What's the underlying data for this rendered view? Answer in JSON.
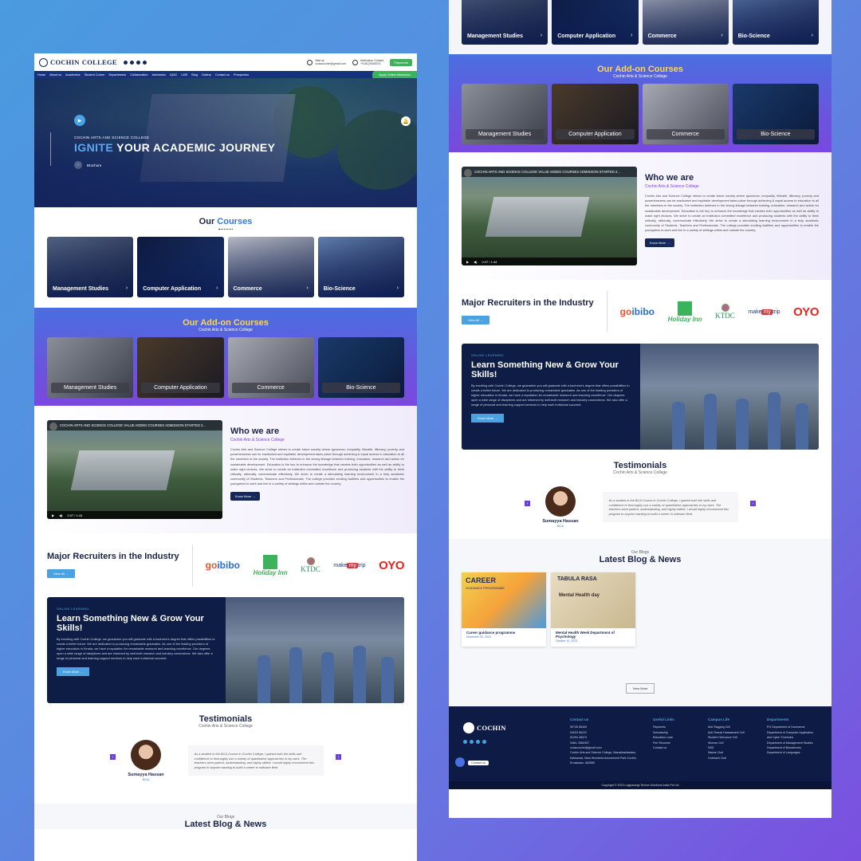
{
  "site": {
    "logo": "COCHIN ARTS & SCIENCE COLLEGE",
    "logo_short": "COCHIN",
    "logo_tail": "COLLEGE"
  },
  "header": {
    "mail_label": "Mail us",
    "mail": "ccasccochin@gmail.com",
    "phone_label": "Admission Contact",
    "phone": "+918129448374",
    "payments": "Payments",
    "apply": "Apply Online Admission"
  },
  "nav": [
    "Home",
    "About us",
    "Academics",
    "Student Corner",
    "Departments",
    "Collaboration",
    "Admission",
    "IQAC",
    "LMS",
    "Blog",
    "Gallery",
    "Contact us",
    "Prospectus"
  ],
  "hero": {
    "sub": "COCHIN ARTS AND SCIENCE COLLEGE",
    "title_hl": "IGNITE",
    "title_rest": " YOUR ACADEMIC JOURNEY",
    "brochure": "Brochure"
  },
  "courses": {
    "title_a": "Our ",
    "title_b": "Courses",
    "items": [
      {
        "label": "Management Studies"
      },
      {
        "label": "Computer Application"
      },
      {
        "label": "Commerce"
      },
      {
        "label": "Bio-Science"
      }
    ]
  },
  "addon": {
    "title": "Our Add-on Courses",
    "sub": "Cochin Arts & Science College",
    "items": [
      {
        "label": "Management Studies"
      },
      {
        "label": "Computer Application"
      },
      {
        "label": "Commerce"
      },
      {
        "label": "Bio-Science"
      }
    ]
  },
  "who": {
    "video_title": "COCHIN ARTS AND SCIENCE COLLEGE VALUE ADDED COURSES ADMISSION STARTED 2...",
    "video_time": "0:07 / 1:44",
    "title": "Who we are",
    "sub": "Cochin Arts & Science College",
    "text": "Cochin Arts and Science College strives to create future society where ignorance, inequality, illhealth, illiteracy, poverty and powerlessness can be eradicated and equitable development takes place through achieving & equal access to education to all the members in the society. The institution believes in the strong linkage between training, education, research and action for sustainable development. Education is the key to enhance the knowledge that creates both opportunities as well as ability to make right choices. We strive to create an institution committed excellence and producing students with the ability to think critically, rationally, communicate effectively. We strive to create a stimulating learning environment in a truly academic community of Students, Teachers and Professionals. The college provides exciting facilities and opportunities to enable the youngsters to work and live in a variety of settings within and outside the country.",
    "button": "Know More →"
  },
  "recruiters": {
    "title": "Major Recruiters in the Industry",
    "button": "View All →",
    "logos": {
      "goibibo_a": "go",
      "goibibo_b": "ibibo",
      "holiday": "Holiday Inn",
      "ktdc": "KTDC",
      "mmt_a": "make",
      "mmt_b": "my",
      "mmt_c": "trip",
      "oyo": "OYO"
    }
  },
  "learn": {
    "kicker": "ONLINE LEARNING",
    "title": "Learn Something New & Grow Your Skills!",
    "text": "By enrolling with Cochin College, we guarantee you will graduate with a bachelor's degree that offers possibilities to create a better future. We are dedicated to producing remarkable graduates. As one of the leading providers of higher education in Kerala, we have a reputation for remarkable research and teaching excellence. Our degrees open a wide range of disciplines and are informed by well-built research and industry connections. We also offer a range of personal and learning support services to help each individual succeed.",
    "button": "Know More →"
  },
  "testimonials": {
    "title": "Testimonials",
    "sub": "Cochin Arts & Science College",
    "name": "Sumayya Hassan",
    "course": "BCA",
    "quote": "As a student in the BCA Course in Cochin College, I gained both the skills and confidence to thoroughly use a variety of quantitative approaches in my work. The teachers were patient, understanding, and highly skilled. I would highly recommend this program to anyone wanting to build a career in software field."
  },
  "blog": {
    "kicker": "Our Blogs",
    "title": "Latest Blog & News",
    "posts": [
      {
        "title": "Career guidance programme",
        "date": "November 02, 2023",
        "img_a": "CAREER",
        "img_b": "GUIDANCE PROGRAMME"
      },
      {
        "title": "Mental Health Week Department of Psychology",
        "date": "October 10, 2023",
        "img_a": "TABULA RASA",
        "img_b": "Mental Health day"
      }
    ],
    "button": "View More"
  },
  "footer": {
    "contact_h": "Contact us",
    "contact": [
      "90745 56405",
      "94003 56222",
      "81294 48374",
      "0484- 2560357",
      "ccasccochin@gmail.com",
      "Cochin Arts and Science College, Manakkakkadavu,",
      "Kakkanad, Near Wonderla Amusement Park Cochin,",
      "Ernakulam, 683565"
    ],
    "links_h": "Useful Links",
    "links": [
      "Payments",
      "Scholarship",
      "Education Loan",
      "Fee Structure",
      "Contact us"
    ],
    "campus_h": "Campus Life",
    "campus": [
      "Anti Ragging Cell",
      "Anti Sexual Harassment Cell",
      "Student Grievance Cell",
      "Women Cell",
      "NSS",
      "Nature Club",
      "Outreach Club"
    ],
    "dept_h": "Departments",
    "depts": [
      "PG Department of Commerce",
      "Department of Computer Application and Cyber Forensics",
      "Department of Management Studies",
      "Department of Biosciences",
      "Department of Languages"
    ],
    "chat": "Contact us",
    "copyright": "Copyright © 2023 Logiparangi Techno Solutions India Pvt Ltd"
  },
  "colors": {
    "navy": "#16327a",
    "accent": "#2f7ad8",
    "green": "#3cb35a",
    "purple": "#7a48e0"
  }
}
